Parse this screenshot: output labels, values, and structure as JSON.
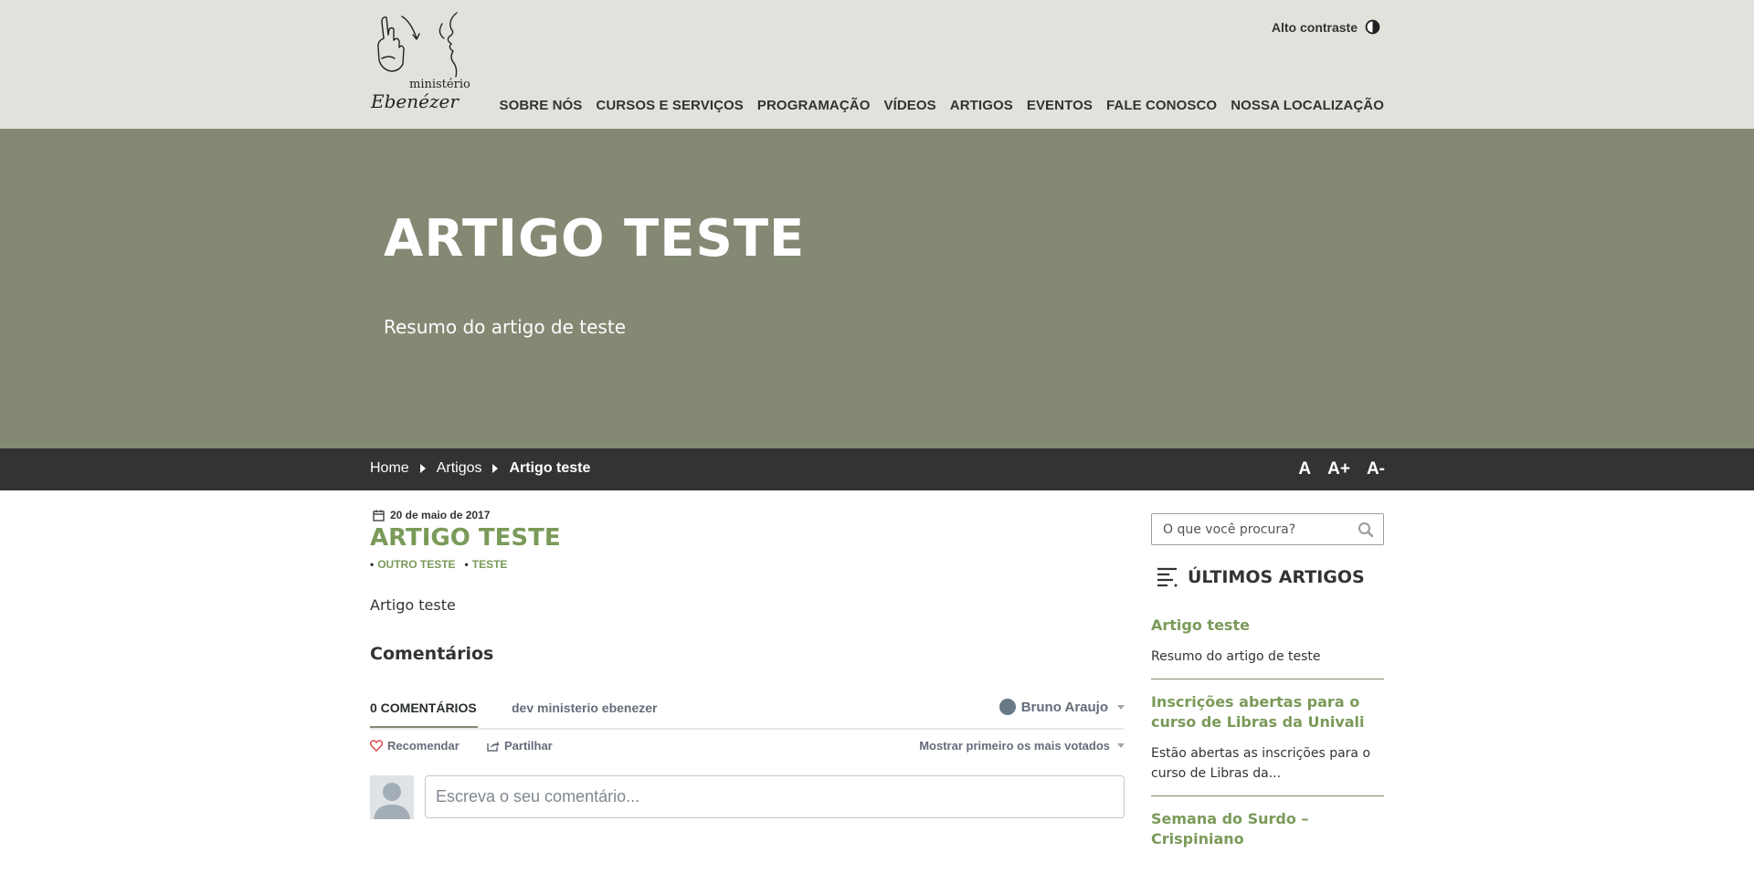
{
  "header": {
    "logo_text_line1": "ministério",
    "logo_text_line2": "Ebenézer",
    "contrast_label": "Alto contraste",
    "nav": [
      {
        "label": "SOBRE NÓS"
      },
      {
        "label": "CURSOS E SERVIÇOS"
      },
      {
        "label": "PROGRAMAÇÃO"
      },
      {
        "label": "VÍDEOS"
      },
      {
        "label": "ARTIGOS"
      },
      {
        "label": "EVENTOS"
      },
      {
        "label": "FALE CONOSCO"
      },
      {
        "label": "NOSSA LOCALIZAÇÃO"
      }
    ]
  },
  "hero": {
    "title": "ARTIGO TESTE",
    "summary": "Resumo do artigo de teste",
    "background_color": "#838973"
  },
  "breadcrumb": {
    "items": [
      "Home",
      "Artigos"
    ],
    "current": "Artigo teste",
    "font_controls": [
      "A",
      "A+",
      "A-"
    ]
  },
  "article": {
    "date": "20 de maio de 2017",
    "title": "ARTIGO TESTE",
    "tags": [
      "OUTRO TESTE",
      "TESTE"
    ],
    "body": "Artigo teste",
    "accent_color": "#7a9a59"
  },
  "comments": {
    "heading": "Comentários",
    "count_tab": "0 COMENTÁRIOS",
    "community": "dev ministerio ebenezer",
    "user": "Bruno Araujo",
    "recommend": "Recomendar",
    "share": "Partilhar",
    "sort": "Mostrar primeiro os mais votados",
    "input_placeholder": "Escreva o seu comentário..."
  },
  "sidebar": {
    "search_placeholder": "O que você procura?",
    "latest_heading": "ÚLTIMOS ARTIGOS",
    "latest": [
      {
        "title": "Artigo teste",
        "summary": "Resumo do artigo de teste"
      },
      {
        "title": "Inscrições abertas para o curso de Libras da Univali",
        "summary": "Estão abertas as inscrições para o curso de Libras da..."
      },
      {
        "title": "Semana do Surdo – Crispiniano",
        "summary": ""
      }
    ]
  }
}
